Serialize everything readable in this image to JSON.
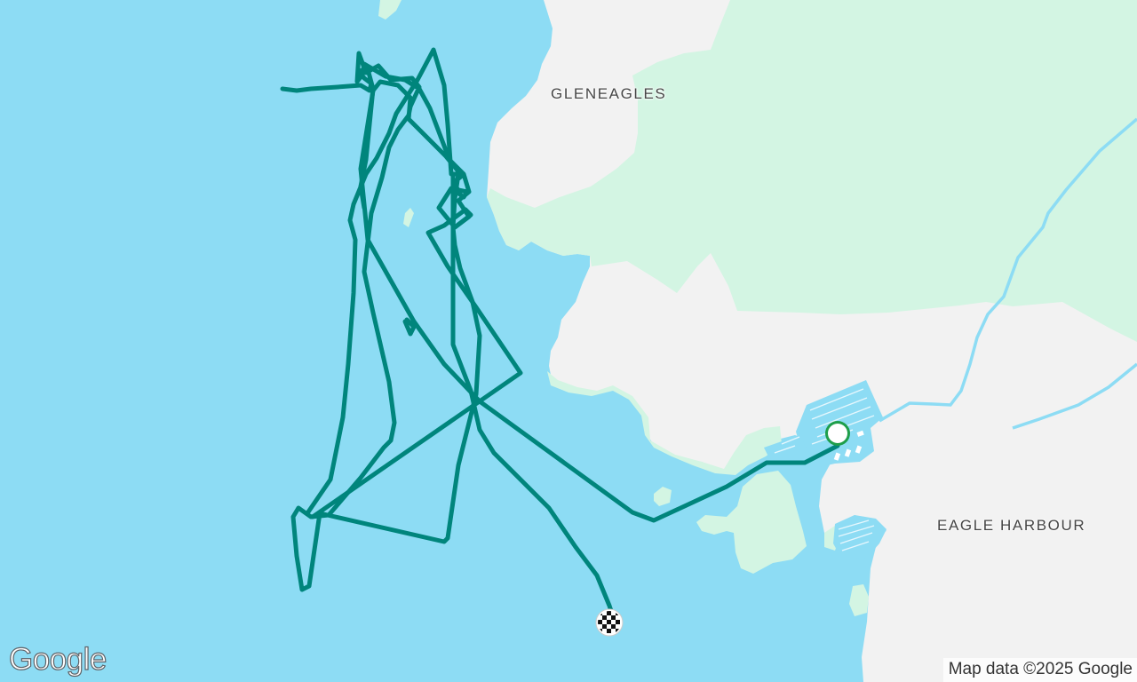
{
  "map": {
    "places": [
      {
        "name": "GLENEAGLES"
      },
      {
        "name": "EAGLE HARBOUR"
      }
    ],
    "colors": {
      "water": "#8ddcf4",
      "land": "#f2f2f2",
      "park": "#d3f5e3",
      "stream": "#8ddcf4",
      "track": "#00857c",
      "start_marker_ring": "#1e9e4a",
      "start_marker_fill": "#ffffff"
    },
    "route": {
      "start_marker": "start-circle-icon",
      "end_marker": "checkered-flag-icon"
    }
  },
  "branding": {
    "logo": "Google",
    "attribution": "Map data ©2025 Google"
  }
}
